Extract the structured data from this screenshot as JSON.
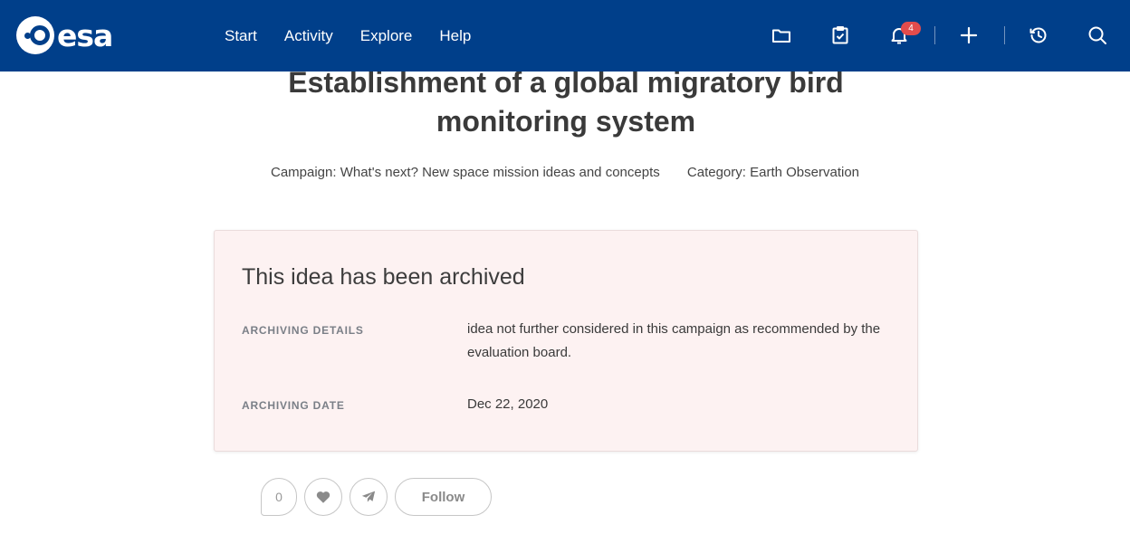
{
  "header": {
    "logo_text": "esa",
    "nav": [
      "Start",
      "Activity",
      "Explore",
      "Help"
    ],
    "notifications_count": "4",
    "icons": [
      "folder-icon",
      "clipboard-check-icon",
      "bell-icon",
      "plus-icon",
      "history-icon",
      "search-icon"
    ],
    "background_color": "#003f8a"
  },
  "idea": {
    "title": "Establishment of a global migratory bird monitoring system",
    "campaign": "Campaign: What's next? New space mission ideas and concepts",
    "category": "Category: Earth Observation"
  },
  "archive": {
    "heading": "This idea has been archived",
    "details_label": "ARCHIVING DETAILS",
    "details_value": "idea not further considered in this campaign as recommended by the evaluation board.",
    "date_label": "ARCHIVING DATE",
    "date_value": "Dec 22, 2020"
  },
  "actions": {
    "comment_count": "0",
    "follow_label": "Follow"
  }
}
